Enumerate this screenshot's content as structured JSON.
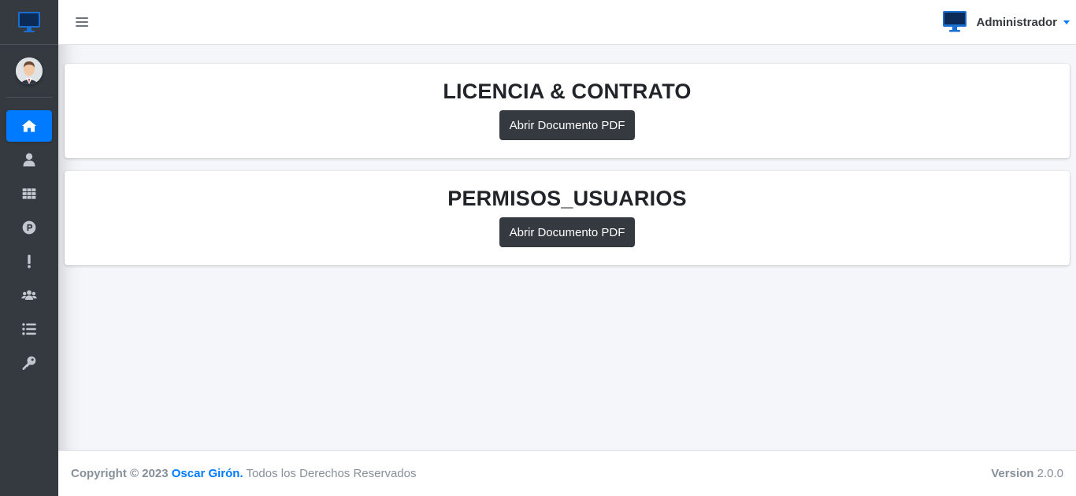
{
  "navbar": {
    "user_name": "Administrador"
  },
  "sidebar": {
    "items": [
      {
        "icon": "home-icon",
        "active": true
      },
      {
        "icon": "user-icon",
        "active": false
      },
      {
        "icon": "grid-icon",
        "active": false
      },
      {
        "icon": "parking-icon",
        "active": false
      },
      {
        "icon": "exclamation-icon",
        "active": false
      },
      {
        "icon": "users-icon",
        "active": false
      },
      {
        "icon": "list-icon",
        "active": false
      },
      {
        "icon": "key-icon",
        "active": false
      }
    ]
  },
  "cards": [
    {
      "title": "LICENCIA & CONTRATO",
      "button_label": "Abrir Documento PDF"
    },
    {
      "title": "PERMISOS_USUARIOS",
      "button_label": "Abrir Documento PDF"
    }
  ],
  "footer": {
    "copyright_prefix": "Copyright © 2023",
    "author": "Oscar Girón.",
    "rights": "Todos los Derechos Reservados",
    "version_label": "Version",
    "version_value": "2.0.0"
  },
  "colors": {
    "sidebar_bg": "#343a40",
    "accent": "#007bff",
    "button_bg": "#343a40"
  }
}
